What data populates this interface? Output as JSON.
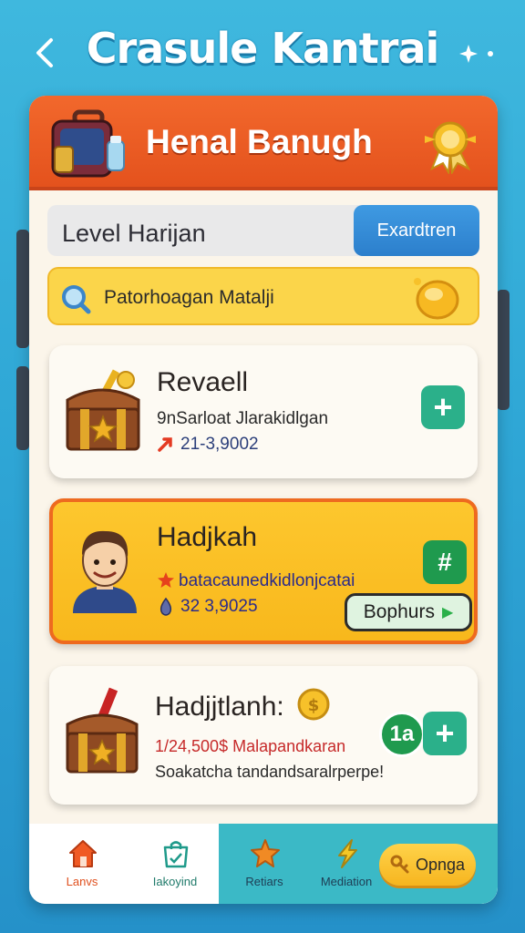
{
  "app": {
    "title": "Crasule Kantrai"
  },
  "panel": {
    "title": "Henal Banugh"
  },
  "level": {
    "label": "Level Harijan",
    "button": "Exardtren"
  },
  "search": {
    "text": "Patorhoagan Matalji"
  },
  "cards": [
    {
      "title": "Revaell",
      "line1": "9nSarloat Jlarakidlgan",
      "line2": "21-3,9002"
    },
    {
      "title": "Hadjkah",
      "line1": "batacaunedkidlonjcatai",
      "line2": "32 3,9025",
      "button": "Bophurs"
    },
    {
      "title": "Hadjjtlanh:",
      "badge": "1a",
      "line1": "1/24,500$ Malapandkaran",
      "line2": "Soakatcha tandandsaralrperpe!"
    }
  ],
  "nav": [
    {
      "label": "Lanvs"
    },
    {
      "label": "Iakoyind"
    },
    {
      "label": "Retiars"
    },
    {
      "label": "Mediation"
    }
  ],
  "options": {
    "label": "Opnga"
  },
  "colors": {
    "header": "#e4521d",
    "accent_yellow": "#f8b81c",
    "plus_green": "#2bb08a",
    "nav_active": "#3bb9c6"
  }
}
